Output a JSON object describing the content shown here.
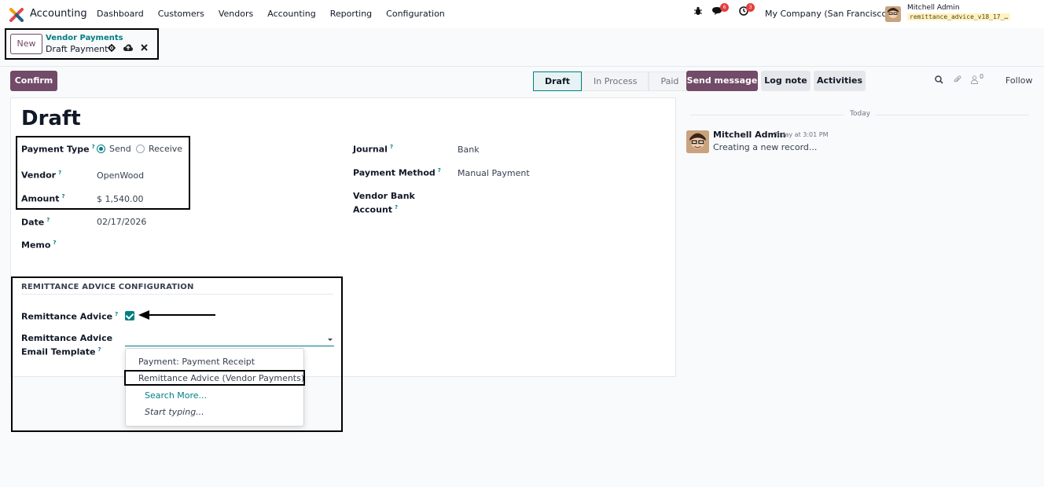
{
  "navbar": {
    "app_name": "Accounting",
    "menu": [
      "Dashboard",
      "Customers",
      "Vendors",
      "Accounting",
      "Reporting",
      "Configuration"
    ],
    "messages_count": "6",
    "activities_count": "3",
    "company": "My Company (San Francisco)",
    "user_name": "Mitchell Admin",
    "database": "remittance_advice_v18_17_…"
  },
  "breadcrumb": {
    "new_label": "New",
    "parent": "Vendor Payments",
    "current": "Draft Payment"
  },
  "actions": {
    "confirm_label": "Confirm"
  },
  "statusbar": {
    "stages": [
      "Draft",
      "In Process",
      "Paid"
    ],
    "active": "Draft"
  },
  "chatter": {
    "send_message": "Send message",
    "log_note": "Log note",
    "activities": "Activities",
    "attachments_count": "0",
    "follow": "Follow",
    "today": "Today",
    "message": {
      "author": "Mitchell Admin",
      "time": "Today at 3:01 PM",
      "body": "Creating a new record..."
    }
  },
  "form": {
    "title": "Draft",
    "payment_type": {
      "label": "Payment Type",
      "options": [
        "Send",
        "Receive"
      ],
      "selected": "Send"
    },
    "vendor": {
      "label": "Vendor",
      "value": "OpenWood"
    },
    "amount": {
      "label": "Amount",
      "value": "$ 1,540.00"
    },
    "date": {
      "label": "Date",
      "value": "02/17/2026"
    },
    "memo": {
      "label": "Memo",
      "value": ""
    },
    "journal": {
      "label": "Journal",
      "value": "Bank"
    },
    "payment_method": {
      "label": "Payment Method",
      "value": "Manual Payment"
    },
    "vendor_bank_account": {
      "label_line1": "Vendor Bank",
      "label_line2": "Account",
      "value": ""
    },
    "help_mark": "?"
  },
  "remittance": {
    "section_title": "REMITTANCE ADVICE CONFIGURATION",
    "advice_label": "Remittance Advice",
    "advice_checked": true,
    "template_label_line1": "Remittance Advice",
    "template_label_line2": "Email Template",
    "template_value": "",
    "dropdown": {
      "items": [
        "Payment: Payment Receipt",
        "Remittance Advice (Vendor Payments)"
      ],
      "search_more": "Search More...",
      "start_typing": "Start typing..."
    }
  },
  "colors": {
    "primary": "#714b67",
    "accent": "#017e84"
  }
}
